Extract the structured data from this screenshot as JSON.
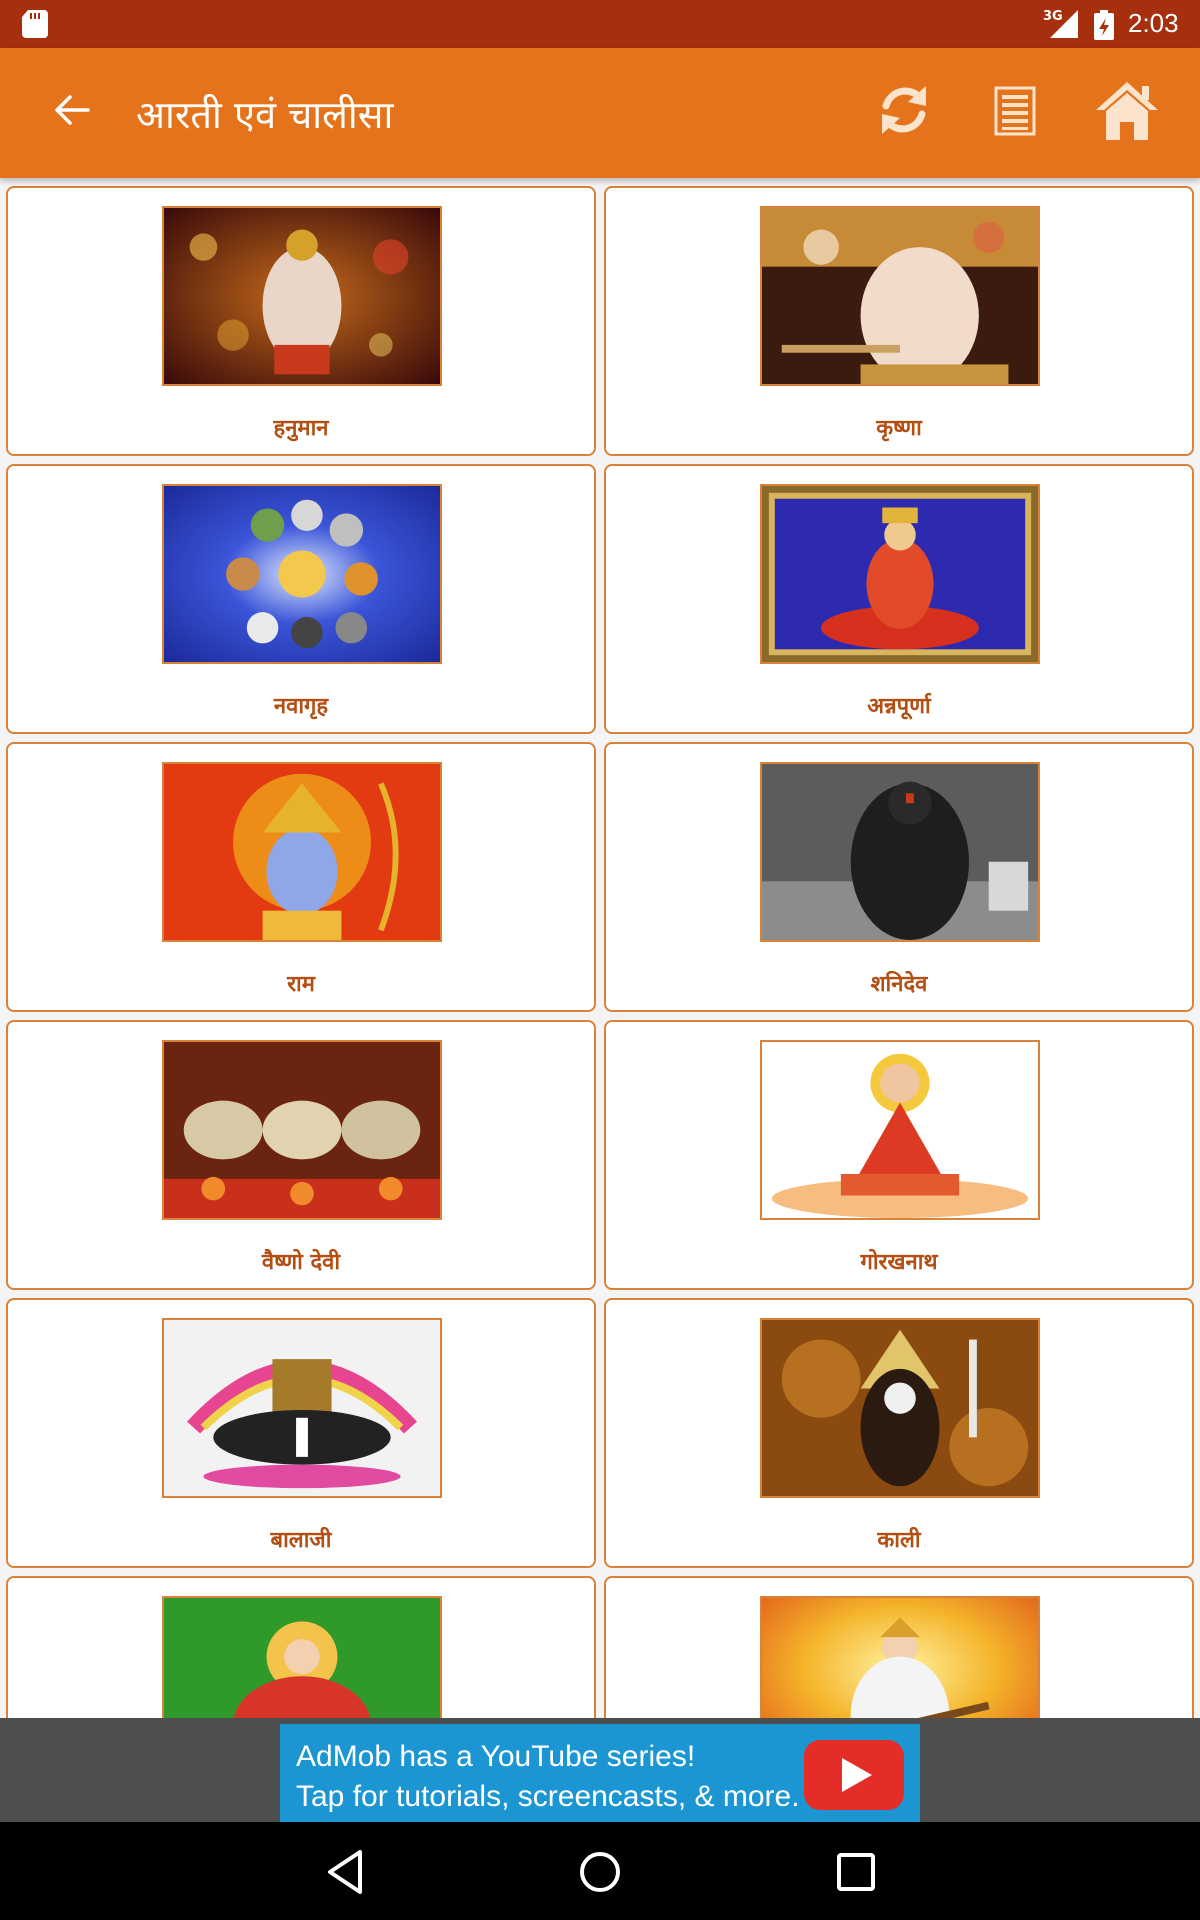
{
  "status_bar": {
    "network": "3G",
    "time": "2:03"
  },
  "app_bar": {
    "title": "आरती एवं चालीसा",
    "icons": [
      "back-arrow-icon",
      "refresh-icon",
      "list-icon",
      "home-icon"
    ]
  },
  "items": [
    {
      "label": "हनुमान",
      "image": "hanuman-image"
    },
    {
      "label": "कृष्णा",
      "image": "krishna-image"
    },
    {
      "label": "नवागृह",
      "image": "navagraha-image"
    },
    {
      "label": "अन्नपूर्णा",
      "image": "annapurna-image"
    },
    {
      "label": "राम",
      "image": "ram-image"
    },
    {
      "label": "शनिदेव",
      "image": "shanidev-image"
    },
    {
      "label": "वैष्णो देवी",
      "image": "vaishno-devi-image"
    },
    {
      "label": "गोरखनाथ",
      "image": "gorakhnath-image"
    },
    {
      "label": "बालाजी",
      "image": "balaji-image"
    },
    {
      "label": "काली",
      "image": "kali-image"
    },
    {
      "label": "",
      "image": "durga-image"
    },
    {
      "label": "",
      "image": "saraswati-image"
    }
  ],
  "ad": {
    "line1": "AdMob has a YouTube series!",
    "line2": "Tap for tutorials, screencasts, & more."
  },
  "colors": {
    "status_bar": "#a6300e",
    "app_bar": "#e5731b",
    "accent": "#d9823a",
    "label": "#b34f12"
  }
}
